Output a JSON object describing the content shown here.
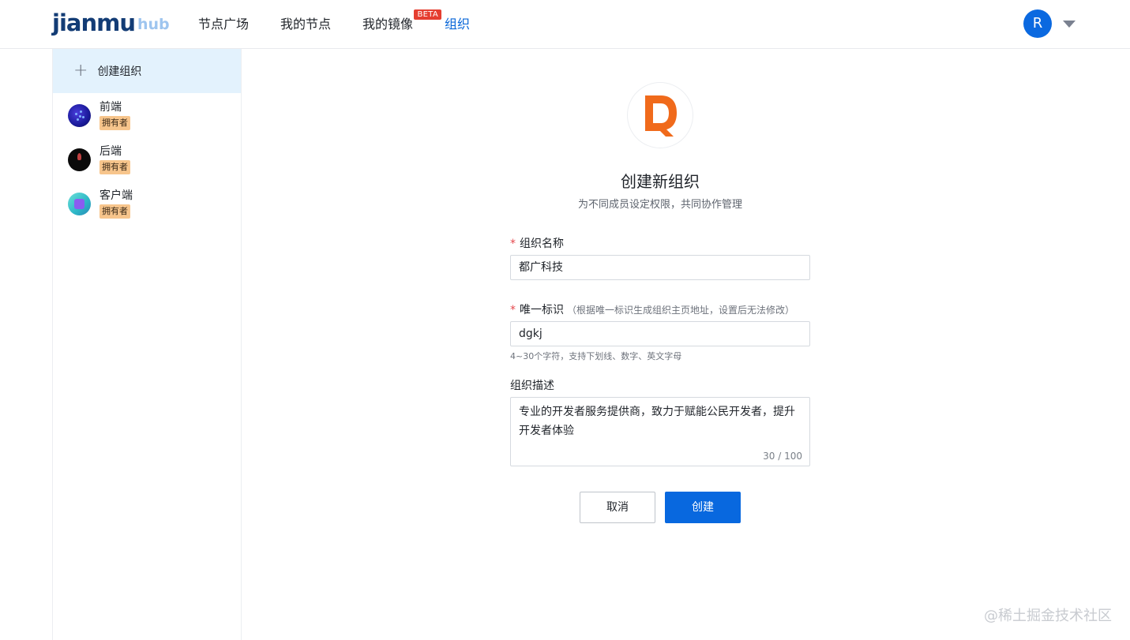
{
  "header": {
    "logo_main": "jianmu",
    "logo_sub": "hub",
    "nav": [
      {
        "label": "节点广场"
      },
      {
        "label": "我的节点"
      },
      {
        "label": "我的镜像",
        "badge": "BETA"
      },
      {
        "label": "组织"
      }
    ],
    "user_initial": "R"
  },
  "sidebar": {
    "create_label": "创建组织",
    "orgs": [
      {
        "name": "前端",
        "role": "拥有者"
      },
      {
        "name": "后端",
        "role": "拥有者"
      },
      {
        "name": "客户端",
        "role": "拥有者"
      }
    ]
  },
  "main": {
    "title": "创建新组织",
    "subtitle": "为不同成员设定权限，共同协作管理",
    "fields": {
      "name": {
        "required_mark": "*",
        "label": "组织名称",
        "value": "都广科技"
      },
      "id": {
        "required_mark": "*",
        "label": "唯一标识",
        "hint": "（根据唯一标识生成组织主页地址，设置后无法修改）",
        "value": "dgkj",
        "helper": "4~30个字符，支持下划线、数字、英文字母"
      },
      "desc": {
        "label": "组织描述",
        "value": "专业的开发者服务提供商，致力于赋能公民开发者，提升开发者体验",
        "counter": "30 / 100"
      }
    },
    "buttons": {
      "cancel": "取消",
      "submit": "创建"
    }
  },
  "watermark": "@稀土掘金技术社区",
  "colors": {
    "accent": "#0868df",
    "brand_orange": "#f06a1b",
    "active_nav": "#0866d8",
    "badge_red": "#e53e30",
    "role_badge": "#f7c58c"
  }
}
